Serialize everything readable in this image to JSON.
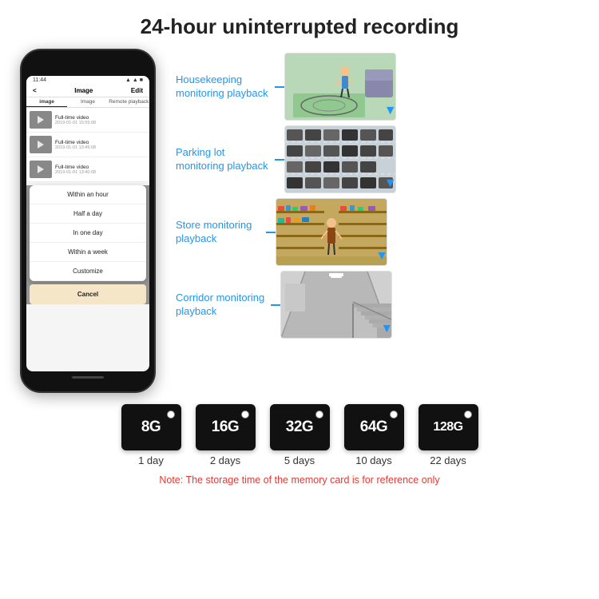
{
  "page": {
    "title": "24-hour uninterrupted recording"
  },
  "phone": {
    "status_time": "11:44",
    "header_back": "<",
    "header_title": "Image",
    "header_edit": "Edit",
    "tabs": [
      "image",
      "Image",
      "Remote playback"
    ],
    "videos": [
      {
        "title": "Full-time video",
        "time": "2019-01-01 15:55:08"
      },
      {
        "title": "Full-time video",
        "time": "2019-01-01 13:45:08"
      },
      {
        "title": "Full-time video",
        "time": "2019-01-01 13:40:08"
      }
    ],
    "dropdown_items": [
      "Within an hour",
      "Half a day",
      "In one day",
      "Within a week",
      "Customize"
    ],
    "cancel_label": "Cancel"
  },
  "monitoring": [
    {
      "label": "Housekeeping\nmonitoring playback",
      "img_class": "img1"
    },
    {
      "label": "Parking lot\nmonitoring playback",
      "img_class": "img2"
    },
    {
      "label": "Store monitoring\nplayback",
      "img_class": "img3"
    },
    {
      "label": "Corridor monitoring\nplayback",
      "img_class": "img4"
    }
  ],
  "memory_cards": [
    {
      "size": "8G",
      "days": "1 day"
    },
    {
      "size": "16G",
      "days": "2 days"
    },
    {
      "size": "32G",
      "days": "5 days"
    },
    {
      "size": "64G",
      "days": "10 days"
    },
    {
      "size": "128G",
      "days": "22 days"
    }
  ],
  "note": "Note: The storage time of the memory card is for reference only"
}
